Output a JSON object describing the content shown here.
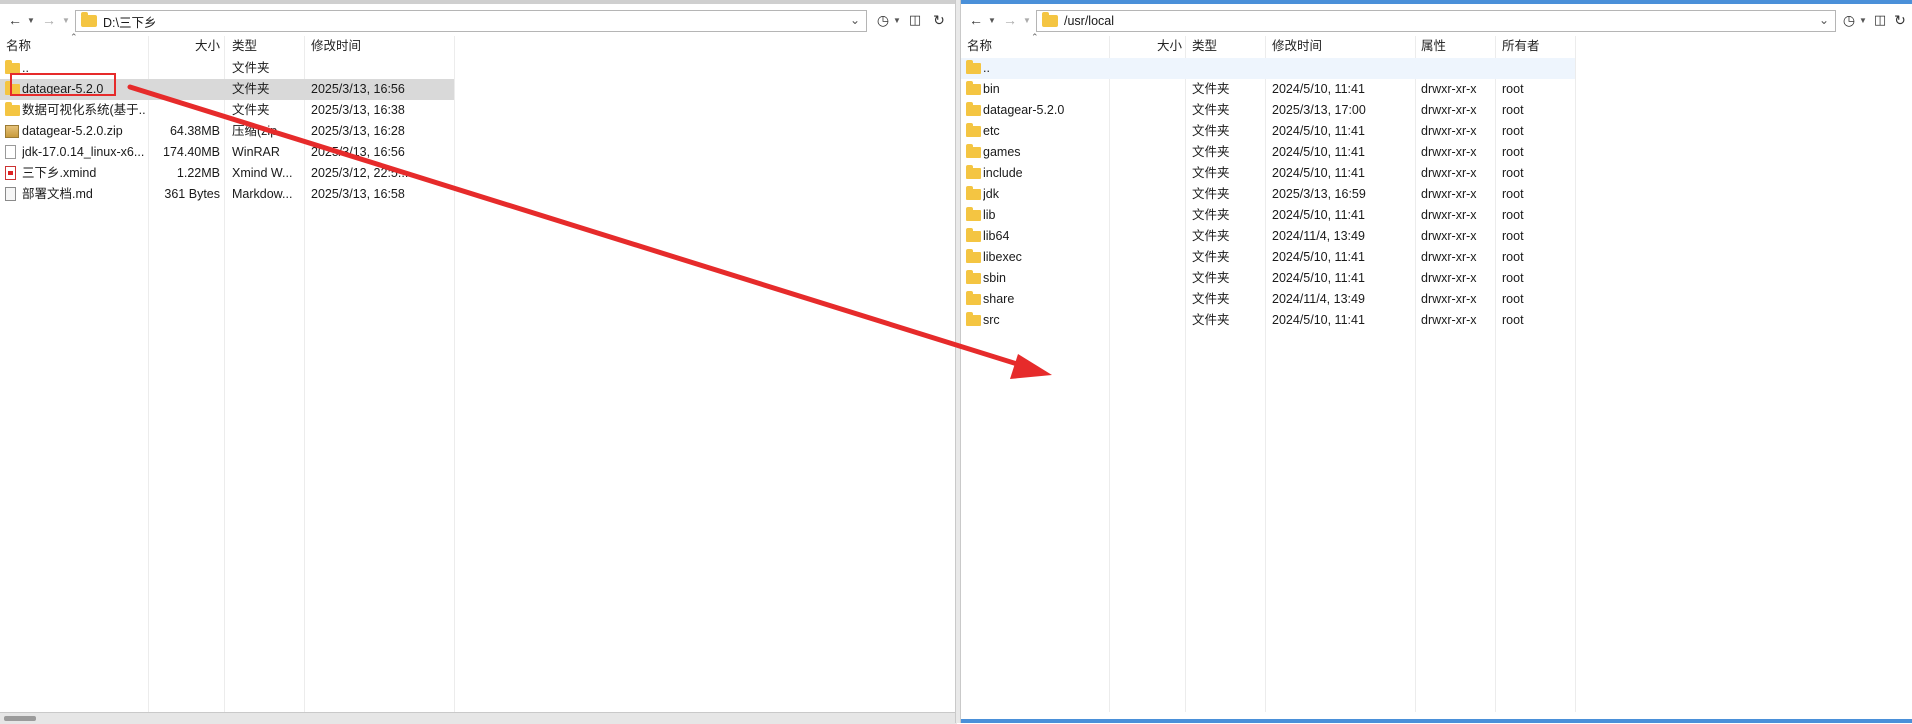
{
  "left": {
    "path": "D:\\三下乡",
    "columns": [
      "名称",
      "大小",
      "类型",
      "修改时间"
    ],
    "rows": [
      {
        "name": "..",
        "size": "",
        "type": "文件夹",
        "modified": "",
        "icon": "folder-icon"
      },
      {
        "name": "datagear-5.2.0",
        "size": "",
        "type": "文件夹",
        "modified": "2025/3/13, 16:56",
        "icon": "folder-icon"
      },
      {
        "name": "数据可视化系统(基于...",
        "size": "",
        "type": "文件夹",
        "modified": "2025/3/13, 16:38",
        "icon": "folder-icon"
      },
      {
        "name": "datagear-5.2.0.zip",
        "size": "64.38MB",
        "type": "压缩(zip...",
        "modified": "2025/3/13, 16:28",
        "icon": "zip-icon"
      },
      {
        "name": "jdk-17.0.14_linux-x6...",
        "size": "174.40MB",
        "type": "WinRAR",
        "modified": "2025/3/13, 16:56",
        "icon": "archive-icon"
      },
      {
        "name": "三下乡.xmind",
        "size": "1.22MB",
        "type": "Xmind W...",
        "modified": "2025/3/12, 22:5...",
        "icon": "xmind-file-icon"
      },
      {
        "name": "部署文档.md",
        "size": "361 Bytes",
        "type": "Markdow...",
        "modified": "2025/3/13, 16:58",
        "icon": "markdown-file-icon"
      }
    ]
  },
  "right": {
    "path": "/usr/local",
    "columns": [
      "名称",
      "大小",
      "类型",
      "修改时间",
      "属性",
      "所有者"
    ],
    "rows": [
      {
        "name": "..",
        "size": "",
        "type": "",
        "modified": "",
        "attrs": "",
        "owner": ""
      },
      {
        "name": "bin",
        "size": "",
        "type": "文件夹",
        "modified": "2024/5/10, 11:41",
        "attrs": "drwxr-xr-x",
        "owner": "root"
      },
      {
        "name": "datagear-5.2.0",
        "size": "",
        "type": "文件夹",
        "modified": "2025/3/13, 17:00",
        "attrs": "drwxr-xr-x",
        "owner": "root"
      },
      {
        "name": "etc",
        "size": "",
        "type": "文件夹",
        "modified": "2024/5/10, 11:41",
        "attrs": "drwxr-xr-x",
        "owner": "root"
      },
      {
        "name": "games",
        "size": "",
        "type": "文件夹",
        "modified": "2024/5/10, 11:41",
        "attrs": "drwxr-xr-x",
        "owner": "root"
      },
      {
        "name": "include",
        "size": "",
        "type": "文件夹",
        "modified": "2024/5/10, 11:41",
        "attrs": "drwxr-xr-x",
        "owner": "root"
      },
      {
        "name": "jdk",
        "size": "",
        "type": "文件夹",
        "modified": "2025/3/13, 16:59",
        "attrs": "drwxr-xr-x",
        "owner": "root"
      },
      {
        "name": "lib",
        "size": "",
        "type": "文件夹",
        "modified": "2024/5/10, 11:41",
        "attrs": "drwxr-xr-x",
        "owner": "root"
      },
      {
        "name": "lib64",
        "size": "",
        "type": "文件夹",
        "modified": "2024/11/4, 13:49",
        "attrs": "drwxr-xr-x",
        "owner": "root"
      },
      {
        "name": "libexec",
        "size": "",
        "type": "文件夹",
        "modified": "2024/5/10, 11:41",
        "attrs": "drwxr-xr-x",
        "owner": "root"
      },
      {
        "name": "sbin",
        "size": "",
        "type": "文件夹",
        "modified": "2024/5/10, 11:41",
        "attrs": "drwxr-xr-x",
        "owner": "root"
      },
      {
        "name": "share",
        "size": "",
        "type": "文件夹",
        "modified": "2024/11/4, 13:49",
        "attrs": "drwxr-xr-x",
        "owner": "root"
      },
      {
        "name": "src",
        "size": "",
        "type": "文件夹",
        "modified": "2024/5/10, 11:41",
        "attrs": "drwxr-xr-x",
        "owner": "root"
      }
    ]
  },
  "toolbar_icons": [
    "back-arrow-icon",
    "dropdown-icon",
    "forward-arrow-icon",
    "bookmark-icon",
    "new-folder-icon",
    "refresh-icon"
  ],
  "colors": {
    "annotation_red": "#e62b2b",
    "folder_yellow": "#f4c542",
    "selection_gray": "#d9d9d9",
    "active_blue": "#4a90d9"
  }
}
